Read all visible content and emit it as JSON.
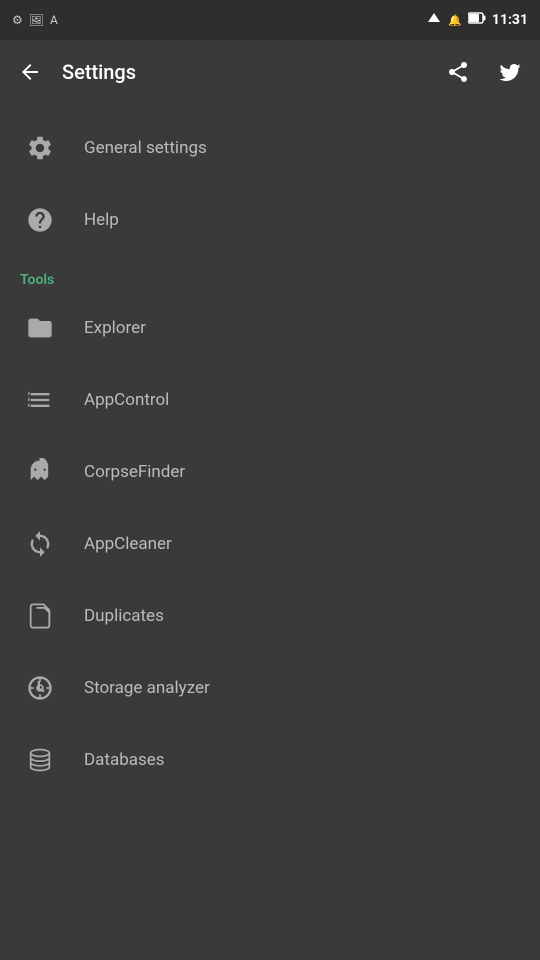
{
  "statusBar": {
    "time": "11:31",
    "icons": [
      "signal",
      "wifi",
      "battery",
      "notification"
    ]
  },
  "appBar": {
    "title": "Settings",
    "backLabel": "back",
    "shareLabel": "share",
    "twitterLabel": "twitter"
  },
  "sections": [
    {
      "header": null,
      "items": [
        {
          "id": "general-settings",
          "label": "General settings",
          "icon": "gear"
        },
        {
          "id": "help",
          "label": "Help",
          "icon": "question"
        }
      ]
    },
    {
      "header": "Tools",
      "items": [
        {
          "id": "explorer",
          "label": "Explorer",
          "icon": "folder"
        },
        {
          "id": "app-control",
          "label": "AppControl",
          "icon": "appcontrol"
        },
        {
          "id": "corpse-finder",
          "label": "CorpseFinder",
          "icon": "ghost"
        },
        {
          "id": "app-cleaner",
          "label": "AppCleaner",
          "icon": "recycle"
        },
        {
          "id": "duplicates",
          "label": "Duplicates",
          "icon": "duplicates"
        },
        {
          "id": "storage-analyzer",
          "label": "Storage analyzer",
          "icon": "storage"
        },
        {
          "id": "databases",
          "label": "Databases",
          "icon": "databases"
        }
      ]
    }
  ]
}
